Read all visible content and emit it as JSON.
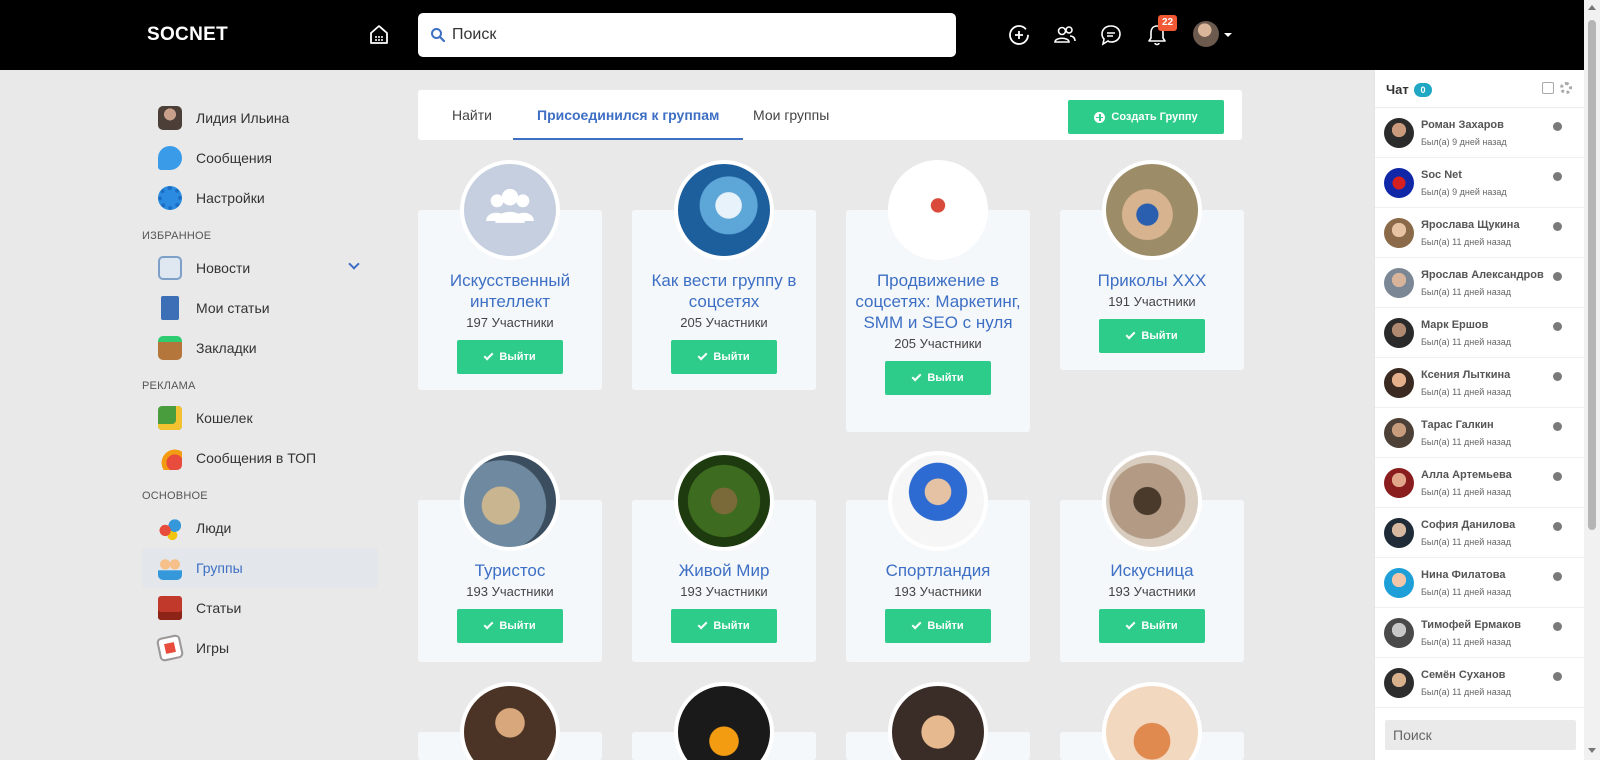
{
  "header": {
    "logo": "SOCNET",
    "search_placeholder": "Поиск",
    "notifications_count": "22",
    "icons": [
      "home-icon",
      "add-circle-icon",
      "friends-icon",
      "messages-icon",
      "bell-icon",
      "avatar",
      "caret-down-icon"
    ]
  },
  "sidebar": {
    "profile_label": "Лидия Ильина",
    "messages_label": "Сообщения",
    "settings_label": "Настройки",
    "section_favorites": "ИЗБРАННОЕ",
    "news_label": "Новости",
    "my_articles_label": "Мои статьи",
    "bookmarks_label": "Закладки",
    "section_ads": "РЕКЛАМА",
    "wallet_label": "Кошелек",
    "top_messages_label": "Сообщения в ТОП",
    "section_main": "ОСНОВНОЕ",
    "people_label": "Люди",
    "groups_label": "Группы",
    "articles_label": "Статьи",
    "games_label": "Игры"
  },
  "tabs": {
    "find": "Найти",
    "joined": "Присоединился к группам",
    "mine": "Мои группы",
    "active": "joined",
    "create_button": "Создать Группу"
  },
  "groups": [
    {
      "title": "Искусственный интеллект",
      "members": "197 Участники",
      "action": "Выйти"
    },
    {
      "title": "Как вести группу в соцсетях",
      "members": "205 Участники",
      "action": "Выйти"
    },
    {
      "title": "Продвижение в соцсетях: Маркетинг, SMM и SEO с нуля",
      "members": "205 Участники",
      "action": "Выйти"
    },
    {
      "title": "Приколы XXX",
      "members": "191 Участники",
      "action": "Выйти"
    },
    {
      "title": "Туристос",
      "members": "193 Участники",
      "action": "Выйти"
    },
    {
      "title": "Живой Мир",
      "members": "193 Участники",
      "action": "Выйти"
    },
    {
      "title": "Спортландия",
      "members": "193 Участники",
      "action": "Выйти"
    },
    {
      "title": "Искусница",
      "members": "193 Участники",
      "action": "Выйти"
    }
  ],
  "chat": {
    "title": "Чат",
    "count": "0",
    "search_placeholder": "Поиск",
    "contacts": [
      {
        "name": "Роман Захаров",
        "status": "Был(а) 9 дней назад"
      },
      {
        "name": "Soc Net",
        "status": "Был(а) 9 дней назад"
      },
      {
        "name": "Ярослава Щукина",
        "status": "Был(а) 11 дней назад"
      },
      {
        "name": "Ярослав Александров",
        "status": "Был(а) 11 дней назад"
      },
      {
        "name": "Марк Ершов",
        "status": "Был(а) 11 дней назад"
      },
      {
        "name": "Ксения Лыткина",
        "status": "Был(а) 11 дней назад"
      },
      {
        "name": "Тарас Галкин",
        "status": "Был(а) 11 дней назад"
      },
      {
        "name": "Алла Артемьева",
        "status": "Был(а) 11 дней назад"
      },
      {
        "name": "София Данилова",
        "status": "Был(а) 11 дней назад"
      },
      {
        "name": "Нина Филатова",
        "status": "Был(а) 11 дней назад"
      },
      {
        "name": "Тимофей Ермаков",
        "status": "Был(а) 11 дней назад"
      },
      {
        "name": "Семён Суханов",
        "status": "Был(а) 11 дней назад"
      }
    ]
  },
  "colors": {
    "accent_blue": "#3d6fc4",
    "button_green": "#2ecc8a",
    "header_black": "#000000",
    "badge_orange": "#f25a35",
    "chat_badge": "#1fa7c4"
  }
}
